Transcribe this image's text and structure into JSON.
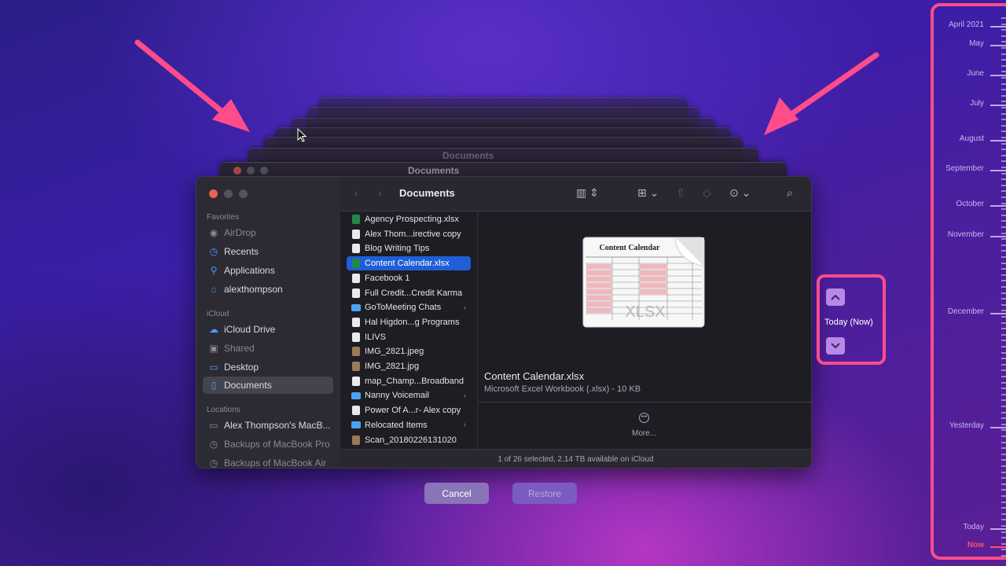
{
  "ghost_title": "Documents",
  "finder": {
    "path_title": "Documents",
    "sidebar": {
      "favorites_header": "Favorites",
      "icloud_header": "iCloud",
      "locations_header": "Locations",
      "favorites": [
        {
          "label": "AirDrop",
          "icon": "airdrop-icon"
        },
        {
          "label": "Recents",
          "icon": "clock-icon"
        },
        {
          "label": "Applications",
          "icon": "applications-icon"
        },
        {
          "label": "alexthompson",
          "icon": "home-icon"
        }
      ],
      "icloud": [
        {
          "label": "iCloud Drive",
          "icon": "cloud-icon"
        },
        {
          "label": "Shared",
          "icon": "shared-folder-icon"
        },
        {
          "label": "Desktop",
          "icon": "desktop-icon"
        },
        {
          "label": "Documents",
          "icon": "document-icon",
          "selected": true
        }
      ],
      "locations": [
        {
          "label": "Alex Thompson's MacB...",
          "icon": "laptop-icon"
        },
        {
          "label": "Backups of MacBook Pro",
          "icon": "backup-clock-icon"
        },
        {
          "label": "Backups of MacBook Air",
          "icon": "backup-clock-icon"
        }
      ]
    },
    "files": [
      {
        "name": "Agency Prospecting.xlsx",
        "type": "xls"
      },
      {
        "name": "Alex Thom...irective copy",
        "type": "doc"
      },
      {
        "name": "Blog Writing Tips",
        "type": "doc"
      },
      {
        "name": "Content Calendar.xlsx",
        "type": "xls",
        "selected": true
      },
      {
        "name": "Facebook 1",
        "type": "doc"
      },
      {
        "name": "Full Credit...Credit Karma",
        "type": "doc"
      },
      {
        "name": "GoToMeeting Chats",
        "type": "folder",
        "has_children": true
      },
      {
        "name": "Hal Higdon...g Programs",
        "type": "doc"
      },
      {
        "name": "ILIVS",
        "type": "doc"
      },
      {
        "name": "IMG_2821.jpeg",
        "type": "img"
      },
      {
        "name": "IMG_2821.jpg",
        "type": "img"
      },
      {
        "name": "map_Champ...Broadband",
        "type": "doc"
      },
      {
        "name": "Nanny Voicemail",
        "type": "folder",
        "has_children": true
      },
      {
        "name": "Power Of A...r- Alex copy",
        "type": "doc"
      },
      {
        "name": "Relocated Items",
        "type": "folder",
        "has_children": true
      },
      {
        "name": "Scan_20180226131020",
        "type": "img"
      }
    ],
    "preview": {
      "thumb_title": "Content Calendar",
      "thumb_ext": "XLSX",
      "file_name": "Content Calendar.xlsx",
      "file_kind": "Microsoft Excel Workbook (.xlsx) - 10 KB",
      "more_label": "More..."
    },
    "status_text": "1 of 26 selected, 2.14 TB available on iCloud"
  },
  "buttons": {
    "cancel": "Cancel",
    "restore": "Restore"
  },
  "time_machine": {
    "today_label": "Today (Now)",
    "timeline": [
      {
        "label": "April 2021"
      },
      {
        "label": "May"
      },
      {
        "label": "June"
      },
      {
        "label": "July"
      },
      {
        "label": "August"
      },
      {
        "label": "September"
      },
      {
        "label": "October"
      },
      {
        "label": "November"
      },
      {
        "label": "December"
      },
      {
        "label": "Yesterday"
      },
      {
        "label": "Today"
      },
      {
        "label": "Now",
        "current": true
      }
    ]
  },
  "colors": {
    "highlight_border": "#ff4c8b",
    "selection_blue": "#1f5ed6",
    "now_red": "#ff4f6a"
  }
}
